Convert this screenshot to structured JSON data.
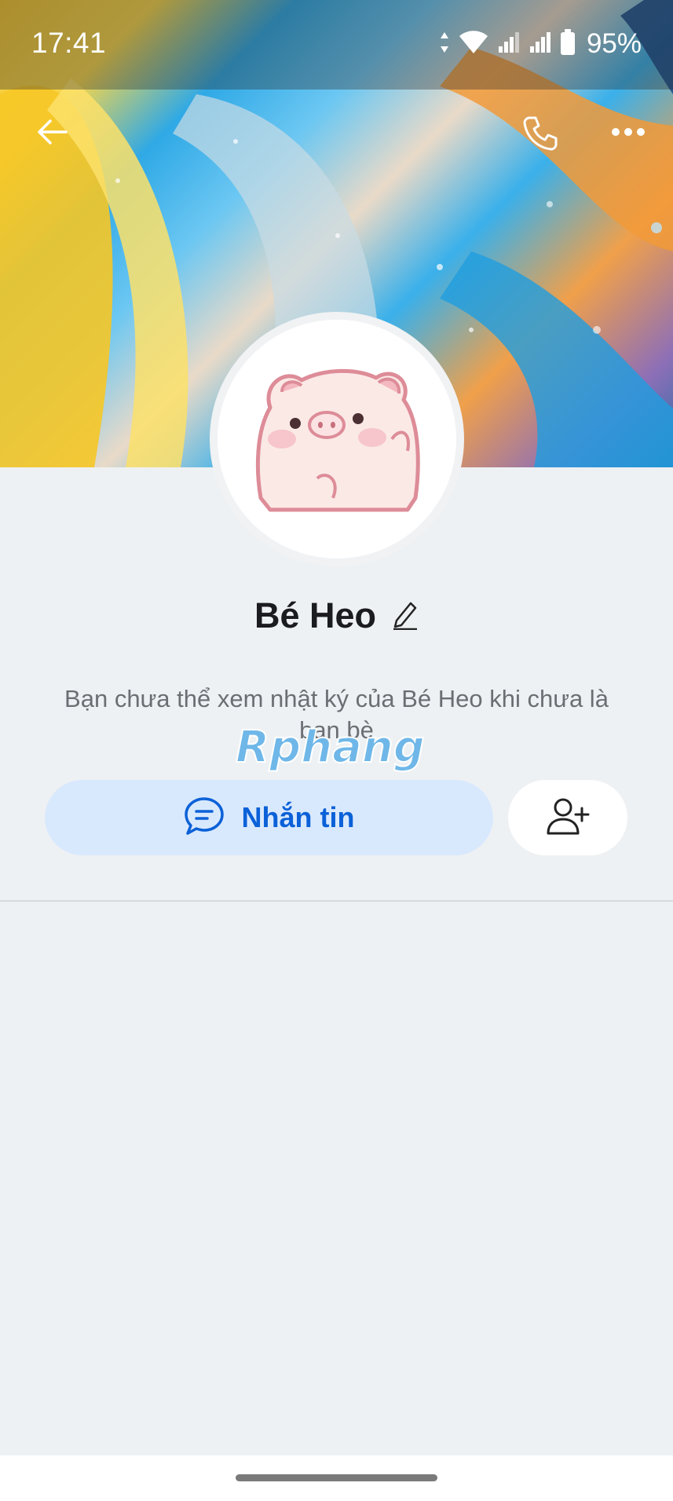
{
  "status_bar": {
    "time": "17:41",
    "battery_percent": "95%",
    "icons": [
      "data-arrows-icon",
      "wifi-icon",
      "signal-icon",
      "signal-icon",
      "battery-icon"
    ]
  },
  "header": {
    "back_icon": "back-arrow-icon",
    "call_icon": "phone-icon",
    "more_icon": "more-icon"
  },
  "profile": {
    "name": "Bé Heo",
    "avatar_icon": "pig-avatar",
    "edit_icon": "pencil-icon",
    "notice": "Bạn chưa thể xem nhật ký của Bé Heo khi chưa là bạn bè"
  },
  "watermark": {
    "text": "Rphang"
  },
  "actions": {
    "message_label": "Nhắn tin",
    "message_icon": "chat-bubble-icon",
    "add_friend_icon": "add-friend-icon"
  },
  "colors": {
    "accent": "#0b61d8",
    "message_button_bg": "#d9e9fd",
    "page_bg": "#eef1f3"
  }
}
